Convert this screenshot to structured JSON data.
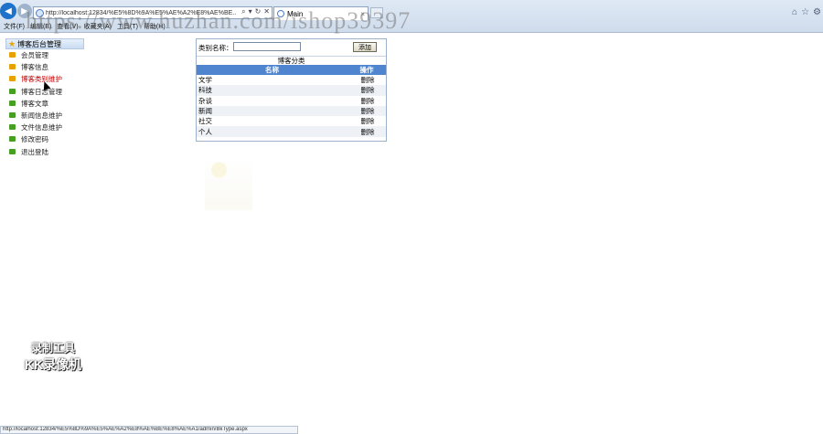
{
  "browser": {
    "address_url": "http://localhost:12834/%E5%8D%9A%E5%AE%A2%E8%AE%BE...",
    "tab_title": "Main",
    "tab_close": "×",
    "menu": [
      "文件(F)",
      "编辑(E)",
      "查看(V)",
      "收藏夹(A)",
      "工具(T)",
      "帮助(H)"
    ],
    "right_icons": [
      "home-icon",
      "star-icon",
      "gear-icon"
    ],
    "status_url": "http://localhost:12834/%E5%8D%9A%E5%AE%A2%E8%AE%BE%E8%AE%A1/admin/BkType.aspx"
  },
  "sidebar": {
    "title": "博客后台管理",
    "items": [
      {
        "label": "会员管理",
        "color": "#e7a100"
      },
      {
        "label": "博客信息",
        "color": "#e7a100"
      },
      {
        "label": "博客类别维护",
        "color": "#e7a100",
        "active": true
      },
      {
        "label": "博客日志管理",
        "color": "#46a020"
      },
      {
        "label": "博客文章",
        "color": "#46a020"
      },
      {
        "label": "新闻信息维护",
        "color": "#46a020"
      },
      {
        "label": "文件信息维护",
        "color": "#46a020"
      },
      {
        "label": "修改密码",
        "color": "#46a020"
      },
      {
        "label": "退出登陆",
        "color": "#46a020"
      }
    ]
  },
  "form": {
    "category_label": "类别名称：",
    "category_value": "",
    "add_button": "添加"
  },
  "table": {
    "caption": "博客分类",
    "headers": {
      "name": "名称",
      "op": "操作"
    },
    "rows": [
      {
        "name": "文学",
        "op": "删除"
      },
      {
        "name": "科技",
        "op": "删除"
      },
      {
        "name": "杂谈",
        "op": "删除"
      },
      {
        "name": "新闻",
        "op": "删除"
      },
      {
        "name": "社交",
        "op": "删除"
      },
      {
        "name": "个人",
        "op": "删除"
      }
    ]
  },
  "overlay": {
    "watermark": "https://www.huzhan.com/ishop39397",
    "rec_line1": "录制工具",
    "rec_line2": "KK录像机"
  },
  "colors": {
    "accent": "#4f84cf",
    "active_link": "#c00000"
  }
}
